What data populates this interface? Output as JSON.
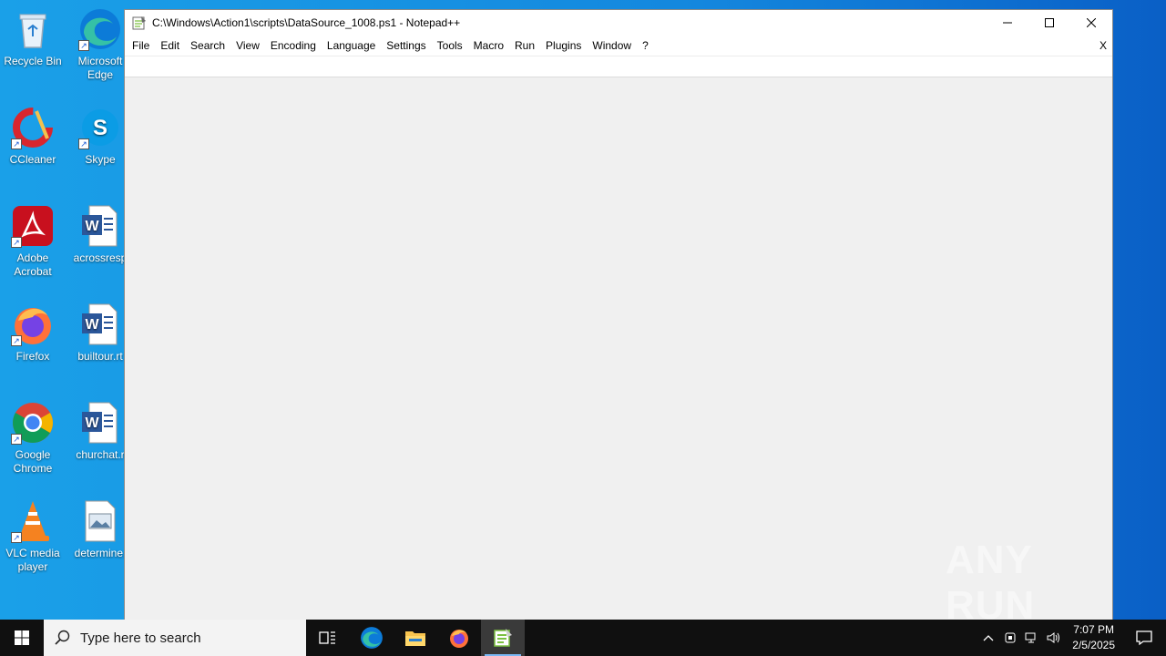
{
  "desktop": {
    "icons": [
      {
        "label": "Recycle Bin"
      },
      {
        "label": "Microsoft Edge"
      },
      {
        "label": "CCleaner"
      },
      {
        "label": "Skype"
      },
      {
        "label": "Adobe Acrobat"
      },
      {
        "label": "acrossresp"
      },
      {
        "label": "Firefox"
      },
      {
        "label": "builtour.rt"
      },
      {
        "label": "Google Chrome"
      },
      {
        "label": "churchat.r"
      },
      {
        "label": "VLC media player"
      },
      {
        "label": "determine."
      }
    ]
  },
  "window": {
    "title": "C:\\Windows\\Action1\\scripts\\DataSource_1008.ps1 - Notepad++",
    "menu": [
      "File",
      "Edit",
      "Search",
      "View",
      "Encoding",
      "Language",
      "Settings",
      "Tools",
      "Macro",
      "Run",
      "Plugins",
      "Window",
      "?"
    ],
    "menu_close": "X"
  },
  "watermark": "ANY RUN",
  "taskbar": {
    "search_placeholder": "Type here to search",
    "time": "7:07 PM",
    "date": "2/5/2025"
  },
  "colors": {
    "desktop": "#1487de",
    "taskbar": "#101010",
    "notepad_green": "#7cc142"
  }
}
